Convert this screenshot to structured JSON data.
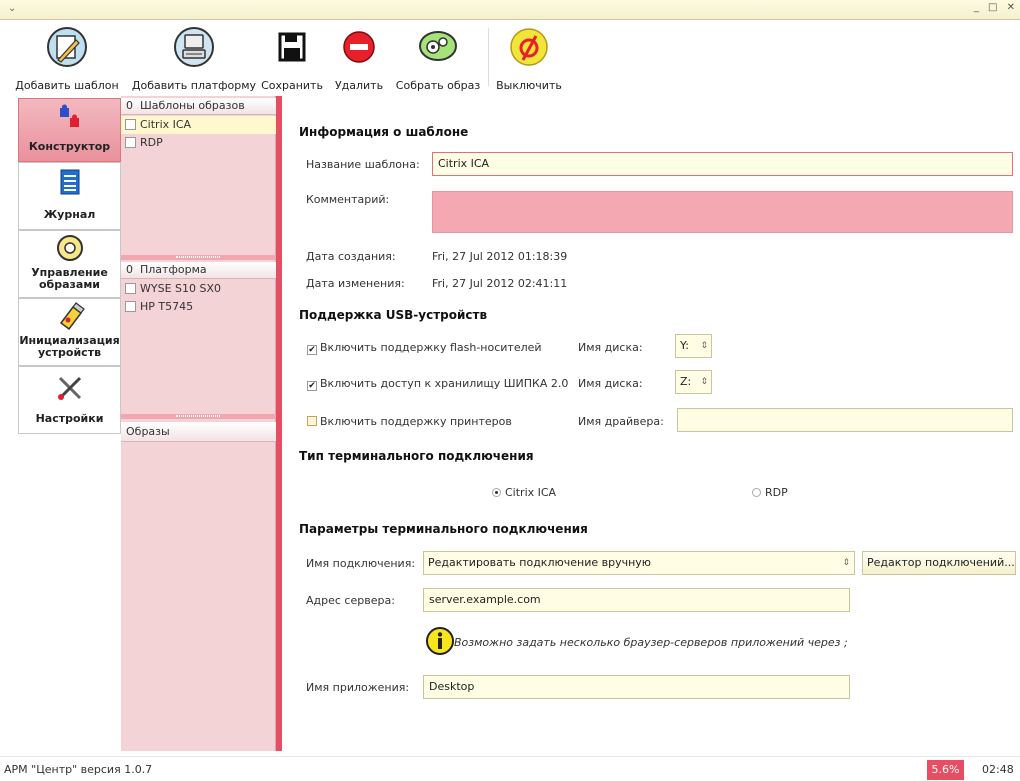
{
  "titlebar": {
    "menu_glyph": "⌄",
    "window_buttons": "_ □ ✕"
  },
  "toolbar": {
    "add_template": {
      "label": "Добавить шаблон",
      "icon": "template-pencil-icon"
    },
    "add_platform": {
      "label": "Добавить платформу",
      "icon": "thin-client-icon"
    },
    "save": {
      "label": "Сохранить",
      "icon": "floppy-icon"
    },
    "delete": {
      "label": "Удалить",
      "icon": "delete-icon"
    },
    "build": {
      "label": "Собрать образ",
      "icon": "gears-icon"
    },
    "power": {
      "label": "Выключить",
      "icon": "power-off-icon"
    }
  },
  "nav": [
    {
      "label": "Конструктор",
      "icon": "puzzle-icon",
      "active": true
    },
    {
      "label": "Журнал",
      "icon": "journal-icon",
      "active": false
    },
    {
      "label": "Управление образами",
      "icon": "disc-icon",
      "active": false
    },
    {
      "label": "Инициализация устройств",
      "icon": "usb-stick-icon",
      "active": false
    },
    {
      "label": "Настройки",
      "icon": "tools-icon",
      "active": false
    }
  ],
  "tree": {
    "templates": {
      "count": "0",
      "title": "Шаблоны образов",
      "items": [
        "Citrix ICA",
        "RDP"
      ]
    },
    "platforms": {
      "count": "0",
      "title": "Платформа",
      "items": [
        "WYSE S10 SX0",
        "HP T5745"
      ]
    },
    "images": {
      "title": "Образы"
    }
  },
  "info": {
    "section_title": "Информация о шаблоне",
    "name_label": "Название шаблона:",
    "name_value": "Citrix ICA",
    "comment_label": "Комментарий:",
    "comment_value": "",
    "created_label": "Дата создания:",
    "created_value": "Fri, 27 Jul 2012 01:18:39",
    "modified_label": "Дата изменения:",
    "modified_value": "Fri, 27 Jul 2012 02:41:11"
  },
  "usb": {
    "section_title": "Поддержка USB-устройств",
    "flash": {
      "label": "Включить поддержку flash-носителей",
      "checked": true,
      "drive_label": "Имя диска:",
      "drive_value": "Y:"
    },
    "shipka": {
      "label": "Включить доступ к хранилищу ШИПКА 2.0",
      "checked": true,
      "drive_label": "Имя диска:",
      "drive_value": "Z:"
    },
    "printers": {
      "label": "Включить поддержку принтеров",
      "checked": false,
      "driver_label": "Имя драйвера:",
      "driver_value": ""
    }
  },
  "conn_type": {
    "section_title": "Тип терминального подключения",
    "citrix": {
      "label": "Citrix ICA",
      "selected": true
    },
    "rdp": {
      "label": "RDP",
      "selected": false
    }
  },
  "conn_params": {
    "section_title": "Параметры терминального подключения",
    "conn_name_label": "Имя подключения:",
    "conn_name_value": "Редактировать подключение вручную",
    "editor_button": "Редактор подключений...",
    "server_label": "Адрес сервера:",
    "server_value": "server.example.com",
    "hint": "Возможно задать несколько браузер-серверов приложений через ;",
    "app_label": "Имя приложения:",
    "app_value": "Desktop"
  },
  "status": {
    "text": "АРМ \"Центр\" версия 1.0.7",
    "cpu": "5.6%",
    "clock": "02:48"
  },
  "colors": {
    "accent": "#e84e63",
    "field_bg": "#fffde3",
    "tree_bg": "#f3d3d6"
  }
}
